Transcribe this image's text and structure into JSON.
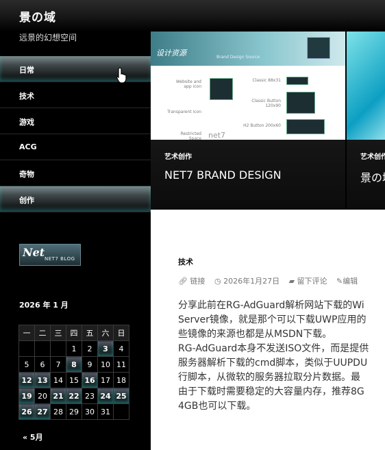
{
  "site": {
    "title": "景の域",
    "tagline": "远景的幻想空间"
  },
  "menu": [
    {
      "label": "日常",
      "active": true
    },
    {
      "label": "技术",
      "active": false
    },
    {
      "label": "游戏",
      "active": false
    },
    {
      "label": "ACG",
      "active": false
    },
    {
      "label": "奇物",
      "active": false
    },
    {
      "label": "创作",
      "active": true
    }
  ],
  "widget_logo": {
    "big": "Net",
    "small": "NET7 BLOG"
  },
  "calendar": {
    "title": "2026 年 1 月",
    "weekdays": [
      "一",
      "二",
      "三",
      "四",
      "五",
      "六",
      "日"
    ],
    "weeks": [
      [
        "",
        "",
        "",
        "1",
        "2",
        "3",
        "4"
      ],
      [
        "5",
        "6",
        "7",
        "8",
        "9",
        "10",
        "11"
      ],
      [
        "12",
        "13",
        "14",
        "15",
        "16",
        "17",
        "18"
      ],
      [
        "19",
        "20",
        "21",
        "22",
        "23",
        "24",
        "25"
      ],
      [
        "26",
        "27",
        "28",
        "29",
        "30",
        "31",
        ""
      ]
    ],
    "linked_days": [
      "3",
      "8",
      "12",
      "13",
      "16",
      "19",
      "21",
      "22",
      "24",
      "25",
      "26",
      "27"
    ],
    "prev": "« 5月"
  },
  "featured": [
    {
      "category": "艺术创作",
      "title": "NET7 BRAND DESIGN",
      "image_text": {
        "heading": "设计资源",
        "sub": "Brand Design Source",
        "labels": [
          "Website and app icon",
          "Transparent icon",
          "Restricted Space",
          "Classic 88x31",
          "Classic Button 120x90",
          "H2 Button 200x60"
        ],
        "wordmark": "net7"
      }
    },
    {
      "category": "艺术创作",
      "title": "景の域"
    }
  ],
  "article": {
    "category": "技术",
    "meta": {
      "type": "链接",
      "date": "2026年1月27日",
      "comments": "留下评论",
      "edit": "编辑"
    },
    "lines": [
      "分享此前在RG-AdGuard解析网站下载的Wi",
      "Server镜像，就是那个可以下载UWP应用的",
      "些镜像的来源也都是从MSDN下载。",
      "RG-AdGuard本身不发送ISO文件，而是提供",
      "服务器解析下载的cmd脚本，类似于UUPDU",
      "行脚本，从微软的服务器拉取分片数据。最",
      "由于下载时需要稳定的大容量内存，推荐8G",
      "4GB也可以下载。"
    ]
  },
  "colors": {
    "accent": "#3cc8c8",
    "sidebar": "#000000"
  }
}
